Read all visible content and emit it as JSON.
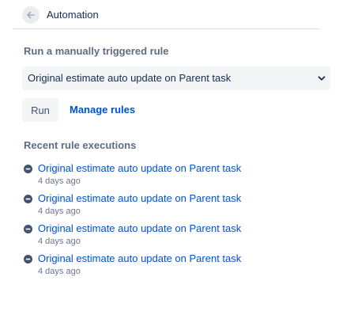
{
  "header": {
    "title": "Automation",
    "back_icon": "arrow-left-icon"
  },
  "manual": {
    "section_label": "Run a manually triggered rule",
    "selected_rule": "Original estimate auto update on Parent task",
    "run_label": "Run",
    "manage_label": "Manage rules"
  },
  "recent": {
    "section_label": "Recent rule executions",
    "items": [
      {
        "name": "Original estimate auto update on Parent task",
        "time": "4 days ago",
        "status_icon": "minus-circle-icon"
      },
      {
        "name": "Original estimate auto update on Parent task",
        "time": "4 days ago",
        "status_icon": "minus-circle-icon"
      },
      {
        "name": "Original estimate auto update on Parent task",
        "time": "4 days ago",
        "status_icon": "minus-circle-icon"
      },
      {
        "name": "Original estimate auto update on Parent task",
        "time": "4 days ago",
        "status_icon": "minus-circle-icon"
      }
    ]
  },
  "colors": {
    "link": "#0052cc",
    "subtle_text": "#5e6c84",
    "status_grey": "#42526e",
    "button_bg": "#f4f5f7"
  }
}
